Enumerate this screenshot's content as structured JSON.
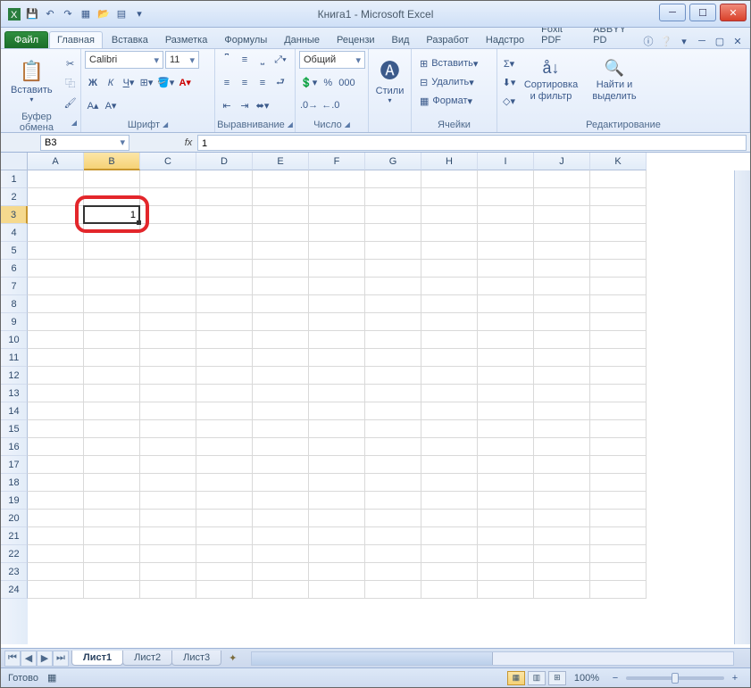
{
  "title": "Книга1 - Microsoft Excel",
  "qa_icons": [
    "excel",
    "save",
    "undo",
    "redo",
    "new",
    "open",
    "preview",
    "dd"
  ],
  "tabs": {
    "file": "Файл",
    "active": "Главная",
    "rest": [
      "Вставка",
      "Разметка",
      "Формулы",
      "Данные",
      "Рецензи",
      "Вид",
      "Разработ",
      "Надстро",
      "Foxit PDF",
      "ABBYY PD"
    ]
  },
  "groups": {
    "clipboard": {
      "label": "Буфер обмена",
      "paste": "Вставить"
    },
    "font": {
      "label": "Шрифт",
      "family": "Calibri",
      "size": "11"
    },
    "align": {
      "label": "Выравнивание"
    },
    "number": {
      "label": "Число",
      "format": "Общий"
    },
    "styles": {
      "label": "Стили",
      "btn": "Стили"
    },
    "cells": {
      "label": "Ячейки",
      "insert": "Вставить",
      "delete": "Удалить",
      "format": "Формат"
    },
    "edit": {
      "label": "Редактирование",
      "sort": "Сортировка и фильтр",
      "find": "Найти и выделить"
    }
  },
  "nameBox": "B3",
  "fxLabel": "fx",
  "formulaValue": "1",
  "cols": [
    "A",
    "B",
    "C",
    "D",
    "E",
    "F",
    "G",
    "H",
    "I",
    "J",
    "K"
  ],
  "rows": 24,
  "activeCol": 1,
  "activeRow": 2,
  "cellValue": "1",
  "sheets": {
    "active": "Лист1",
    "rest": [
      "Лист2",
      "Лист3"
    ]
  },
  "status": "Готово",
  "zoom": "100%"
}
